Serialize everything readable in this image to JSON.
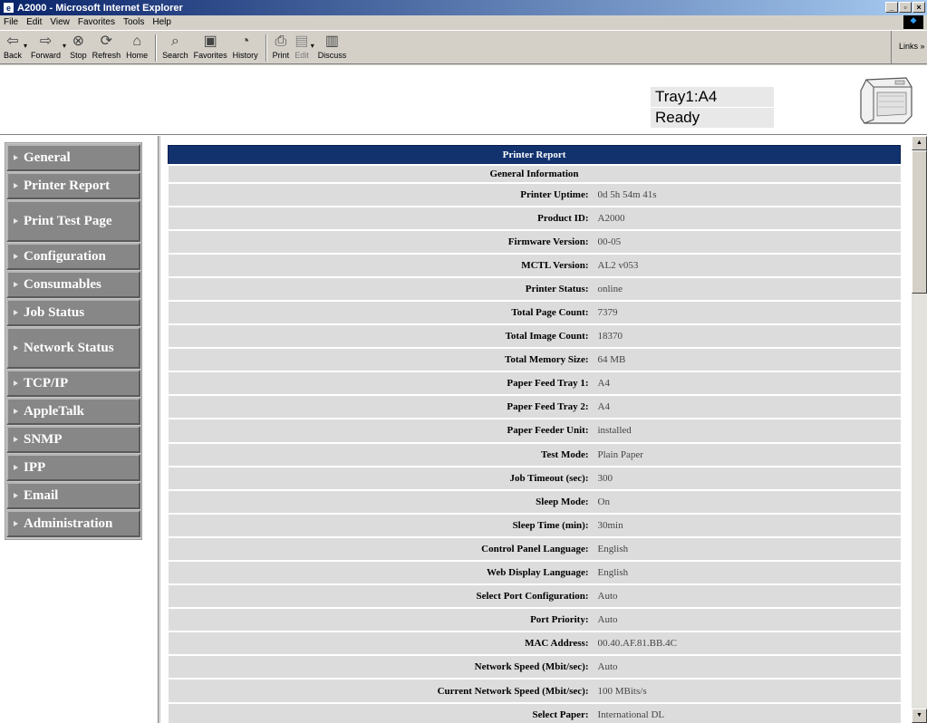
{
  "window": {
    "title": "A2000 - Microsoft Internet Explorer"
  },
  "menu": [
    "File",
    "Edit",
    "View",
    "Favorites",
    "Tools",
    "Help"
  ],
  "toolbar": {
    "back": "Back",
    "forward": "Forward",
    "stop": "Stop",
    "refresh": "Refresh",
    "home": "Home",
    "search": "Search",
    "favorites": "Favorites",
    "history": "History",
    "print": "Print",
    "edit": "Edit",
    "discuss": "Discuss",
    "links": "Links"
  },
  "status": {
    "tray": "Tray1:A4",
    "state": "Ready"
  },
  "sidebar": [
    "General",
    "Printer Report",
    "Print Test Page",
    "Configuration",
    "Consumables",
    "Job Status",
    "Network Status",
    "TCP/IP",
    "AppleTalk",
    "SNMP",
    "IPP",
    "Email",
    "Administration"
  ],
  "report": {
    "title": "Printer Report",
    "section": "General Information",
    "rows": [
      [
        "Printer Uptime:",
        "0d 5h 54m 41s"
      ],
      [
        "Product ID:",
        "A2000"
      ],
      [
        "Firmware Version:",
        "00-05"
      ],
      [
        "MCTL Version:",
        "AL2 v053"
      ],
      [
        "Printer Status:",
        "online"
      ],
      [
        "Total Page Count:",
        "7379"
      ],
      [
        "Total Image Count:",
        "18370"
      ],
      [
        "Total Memory Size:",
        "64 MB"
      ],
      [
        "Paper Feed Tray 1:",
        "A4"
      ],
      [
        "Paper Feed Tray 2:",
        "A4"
      ],
      [
        "Paper Feeder Unit:",
        "installed"
      ],
      [
        "Test Mode:",
        "Plain Paper"
      ],
      [
        "Job Timeout (sec):",
        "300"
      ],
      [
        "Sleep Mode:",
        "On"
      ],
      [
        "Sleep Time (min):",
        "30min"
      ],
      [
        "Control Panel Language:",
        "English"
      ],
      [
        "Web Display Language:",
        "English"
      ],
      [
        "Select Port Configuration:",
        "Auto"
      ],
      [
        "Port Priority:",
        "Auto"
      ],
      [
        "MAC Address:",
        "00.40.AF.81.BB.4C"
      ],
      [
        "Network Speed (Mbit/sec):",
        "Auto"
      ],
      [
        "Current Network Speed (Mbit/sec):",
        "100 MBits/s"
      ],
      [
        "Select Paper:",
        "International DL"
      ]
    ]
  },
  "colors": {
    "title_bar": "#0a246a",
    "report_header": "#12326e",
    "nav_button": "#878787"
  }
}
